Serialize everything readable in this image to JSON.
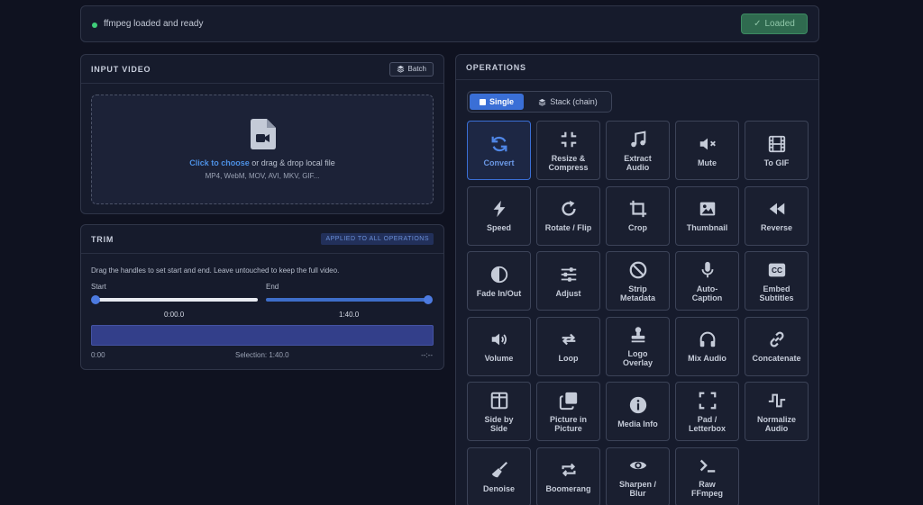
{
  "status": {
    "text": "ffmpeg loaded and ready",
    "loaded_label": "Loaded",
    "dot_color": "#3fce7a"
  },
  "input": {
    "title": "INPUT VIDEO",
    "batch_label": "Batch",
    "drop_link": "Click to choose",
    "drop_text": " or drag & drop local file",
    "formats": "MP4, WebM, MOV, AVI, MKV, GIF..."
  },
  "trim": {
    "title": "TRIM",
    "badge": "APPLIED TO ALL OPERATIONS",
    "hint": "Drag the handles to set start and end. Leave untouched to keep the full video.",
    "start_label": "Start",
    "end_label": "End",
    "start_value": "0:00.0",
    "end_value": "1:40.0",
    "start_fraction": 0,
    "end_fraction": 1,
    "foot_left": "0:00",
    "selection": "Selection: 1:40.0",
    "foot_right": "--:--"
  },
  "operations": {
    "title": "OPERATIONS",
    "mode_single": "Single",
    "mode_stack": "Stack (chain)",
    "selected": "Convert",
    "items": [
      {
        "label": "Convert",
        "icon": "refresh-icon"
      },
      {
        "label": "Resize &\nCompress",
        "icon": "compress-icon"
      },
      {
        "label": "Extract\nAudio",
        "icon": "music-note-icon"
      },
      {
        "label": "Mute",
        "icon": "mute-icon"
      },
      {
        "label": "To GIF",
        "icon": "film-icon"
      },
      {
        "label": "Speed",
        "icon": "bolt-icon"
      },
      {
        "label": "Rotate / Flip",
        "icon": "rotate-icon"
      },
      {
        "label": "Crop",
        "icon": "crop-icon"
      },
      {
        "label": "Thumbnail",
        "icon": "image-icon"
      },
      {
        "label": "Reverse",
        "icon": "rewind-icon"
      },
      {
        "label": "Fade In/Out",
        "icon": "half-circle-icon"
      },
      {
        "label": "Adjust",
        "icon": "sliders-icon"
      },
      {
        "label": "Strip\nMetadata",
        "icon": "ban-icon"
      },
      {
        "label": "Auto-\nCaption",
        "icon": "microphone-icon"
      },
      {
        "label": "Embed\nSubtitles",
        "icon": "cc-icon"
      },
      {
        "label": "Volume",
        "icon": "volume-icon"
      },
      {
        "label": "Loop",
        "icon": "loop-icon"
      },
      {
        "label": "Logo\nOverlay",
        "icon": "stamp-icon"
      },
      {
        "label": "Mix Audio",
        "icon": "headphones-icon"
      },
      {
        "label": "Concatenate",
        "icon": "link-icon"
      },
      {
        "label": "Side by\nSide",
        "icon": "columns-icon"
      },
      {
        "label": "Picture in\nPicture",
        "icon": "pip-icon"
      },
      {
        "label": "Media Info",
        "icon": "info-icon"
      },
      {
        "label": "Pad /\nLetterbox",
        "icon": "expand-icon"
      },
      {
        "label": "Normalize\nAudio",
        "icon": "wave-icon"
      },
      {
        "label": "Denoise",
        "icon": "broom-icon"
      },
      {
        "label": "Boomerang",
        "icon": "repeat-icon"
      },
      {
        "label": "Sharpen /\nBlur",
        "icon": "eye-icon"
      },
      {
        "label": "Raw\nFFmpeg",
        "icon": "terminal-icon"
      }
    ]
  }
}
